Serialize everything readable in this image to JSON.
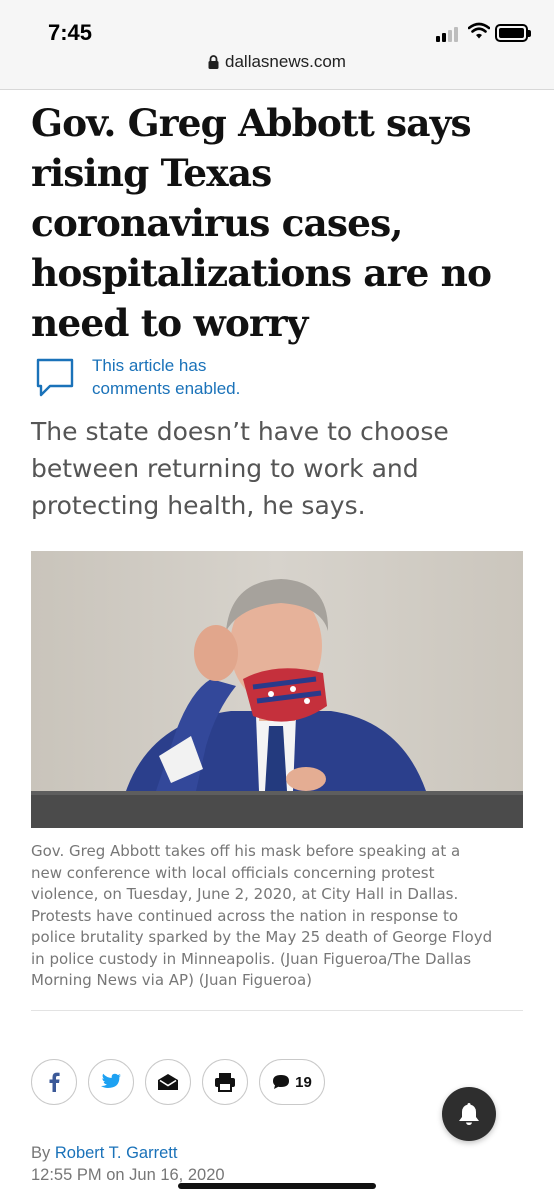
{
  "status_bar": {
    "time": "7:45",
    "url": "dallasnews.com",
    "icons": [
      "signal-icon",
      "wifi-icon",
      "battery-icon",
      "lock-icon"
    ]
  },
  "article": {
    "headline_lines": [
      "Gov. Greg Abbott says",
      "rising Texas",
      "coronavirus cases,",
      "hospitalizations are no",
      "need to worry"
    ],
    "comments_note_lines": [
      "This article has",
      "comments enabled."
    ],
    "dek_lines": [
      "The state doesn’t have to choose",
      "between returning to work and",
      "protecting health, he says."
    ],
    "caption_lines": [
      "Gov. Greg Abbott takes off his mask before speaking at a",
      "new conference with local officials concerning protest",
      "violence, on Tuesday, June 2, 2020, at City Hall in Dallas.",
      "Protests have continued across the nation in response to",
      "police brutality sparked by the May 25 death of George Floyd",
      "in police custody in Minneapolis. (Juan Figueroa/The Dallas",
      "Morning News via AP) (Juan Figueroa)"
    ],
    "share": {
      "buttons": [
        "facebook-icon",
        "twitter-icon",
        "email-icon",
        "print-icon",
        "comment-icon"
      ],
      "comment_count": "19"
    },
    "byline_prefix": "By",
    "author": "Robert T. Garrett",
    "timestamp": "12:55 PM on Jun 16, 2020"
  },
  "colors": {
    "link_blue": "#1a72b9",
    "facebook_blue": "#3b5998",
    "twitter_blue": "#1da1f2",
    "caption_gray": "#777777",
    "bell_bg": "#2e2e2e"
  }
}
